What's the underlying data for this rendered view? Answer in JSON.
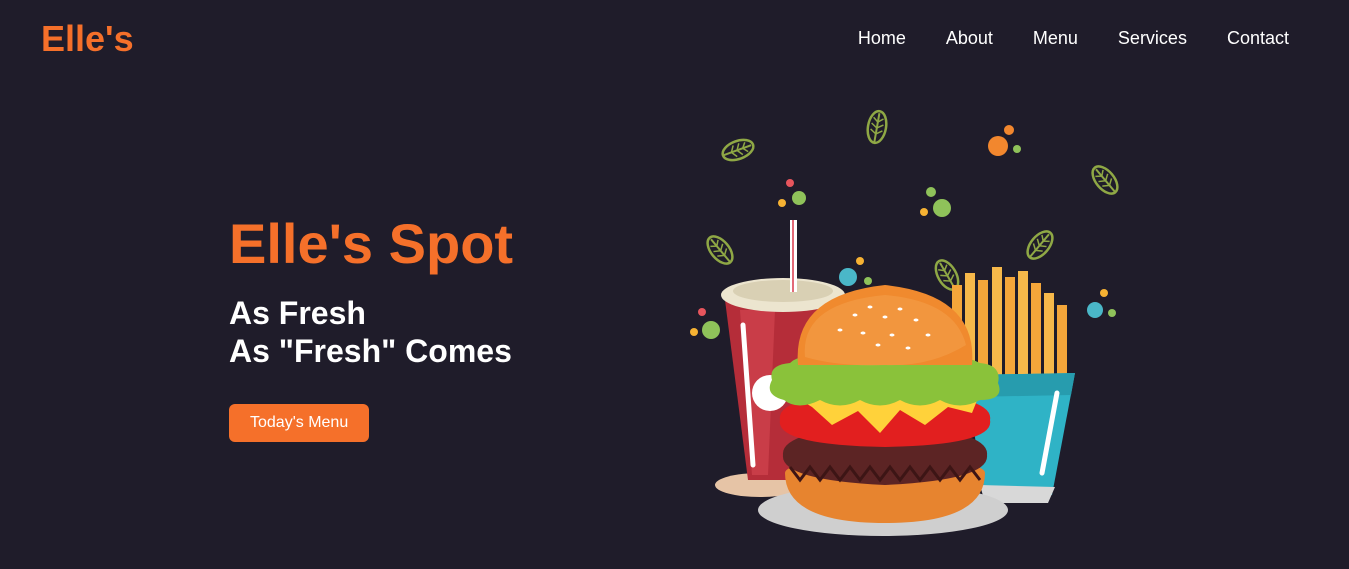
{
  "header": {
    "logo": "Elle's",
    "nav": [
      {
        "label": "Home"
      },
      {
        "label": "About"
      },
      {
        "label": "Menu"
      },
      {
        "label": "Services"
      },
      {
        "label": "Contact"
      }
    ]
  },
  "hero": {
    "title": "Elle's Spot",
    "subtitle_line1": "As Fresh",
    "subtitle_line2": "As \"Fresh\" Comes",
    "button_label": "Today's Menu"
  },
  "illustration": {
    "subject": "burger-fries-drink-illustration"
  },
  "colors": {
    "background": "#1f1c2a",
    "accent": "#f5702a",
    "text": "#ffffff"
  }
}
